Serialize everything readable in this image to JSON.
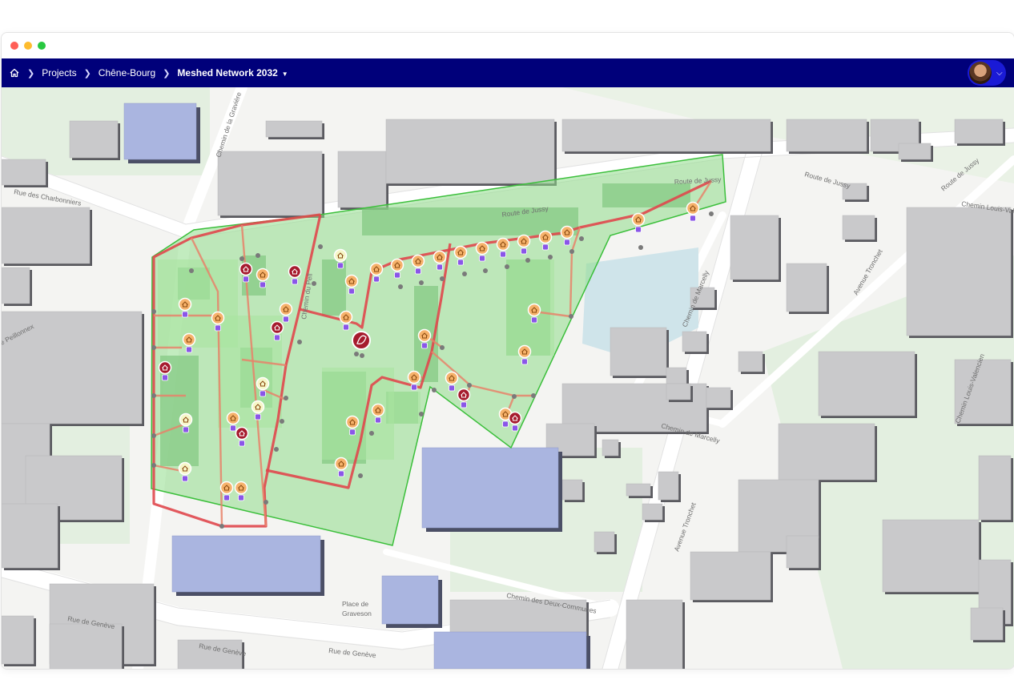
{
  "window": {
    "controls": [
      "close",
      "minimize",
      "zoom"
    ]
  },
  "navbar": {
    "home_icon": "home-icon",
    "breadcrumbs": [
      {
        "label": "Projects"
      },
      {
        "label": "Chêne-Bourg"
      }
    ],
    "current_project": "Meshed Network 2032",
    "avatar_icon": "user-avatar",
    "background": "#00007a"
  },
  "map": {
    "street_labels": [
      "Chemin de la Gravière",
      "Rue des Charbonniers",
      "Route de Jussy",
      "Route de Jussy",
      "Route de Jussy",
      "Route de Jussy",
      "Chemin Louis-Valencien",
      "Chemin de Marcelly",
      "Chemin de Marcelly",
      "Avenue Tronchet",
      "Avenue Tronchet",
      "Chemin Louis-Valencien",
      "Rue de Genève",
      "Rue de Genève",
      "Rue de Genève",
      "Place de",
      "Graveson",
      "Chemin des Deux-Communes",
      "Chemin du Pell",
      "e Peillonnex"
    ],
    "colors": {
      "zone_fill": "#8fdc8a",
      "zone_stroke": "#3bbf3b",
      "network_main": "#e0474c",
      "network_secondary": "#e8826a",
      "node": "#7a7a7a",
      "building_grey": "#c9c9cb",
      "building_highlight": "#aab5e0",
      "consumer_marker": "#f6b26b",
      "producer_marker": "#a61b2e",
      "meter_badge": "#8a56e8"
    },
    "marker_types": [
      "consumer-house-icon",
      "producer-house-icon",
      "heat-plant-icon",
      "meter-icon"
    ]
  }
}
